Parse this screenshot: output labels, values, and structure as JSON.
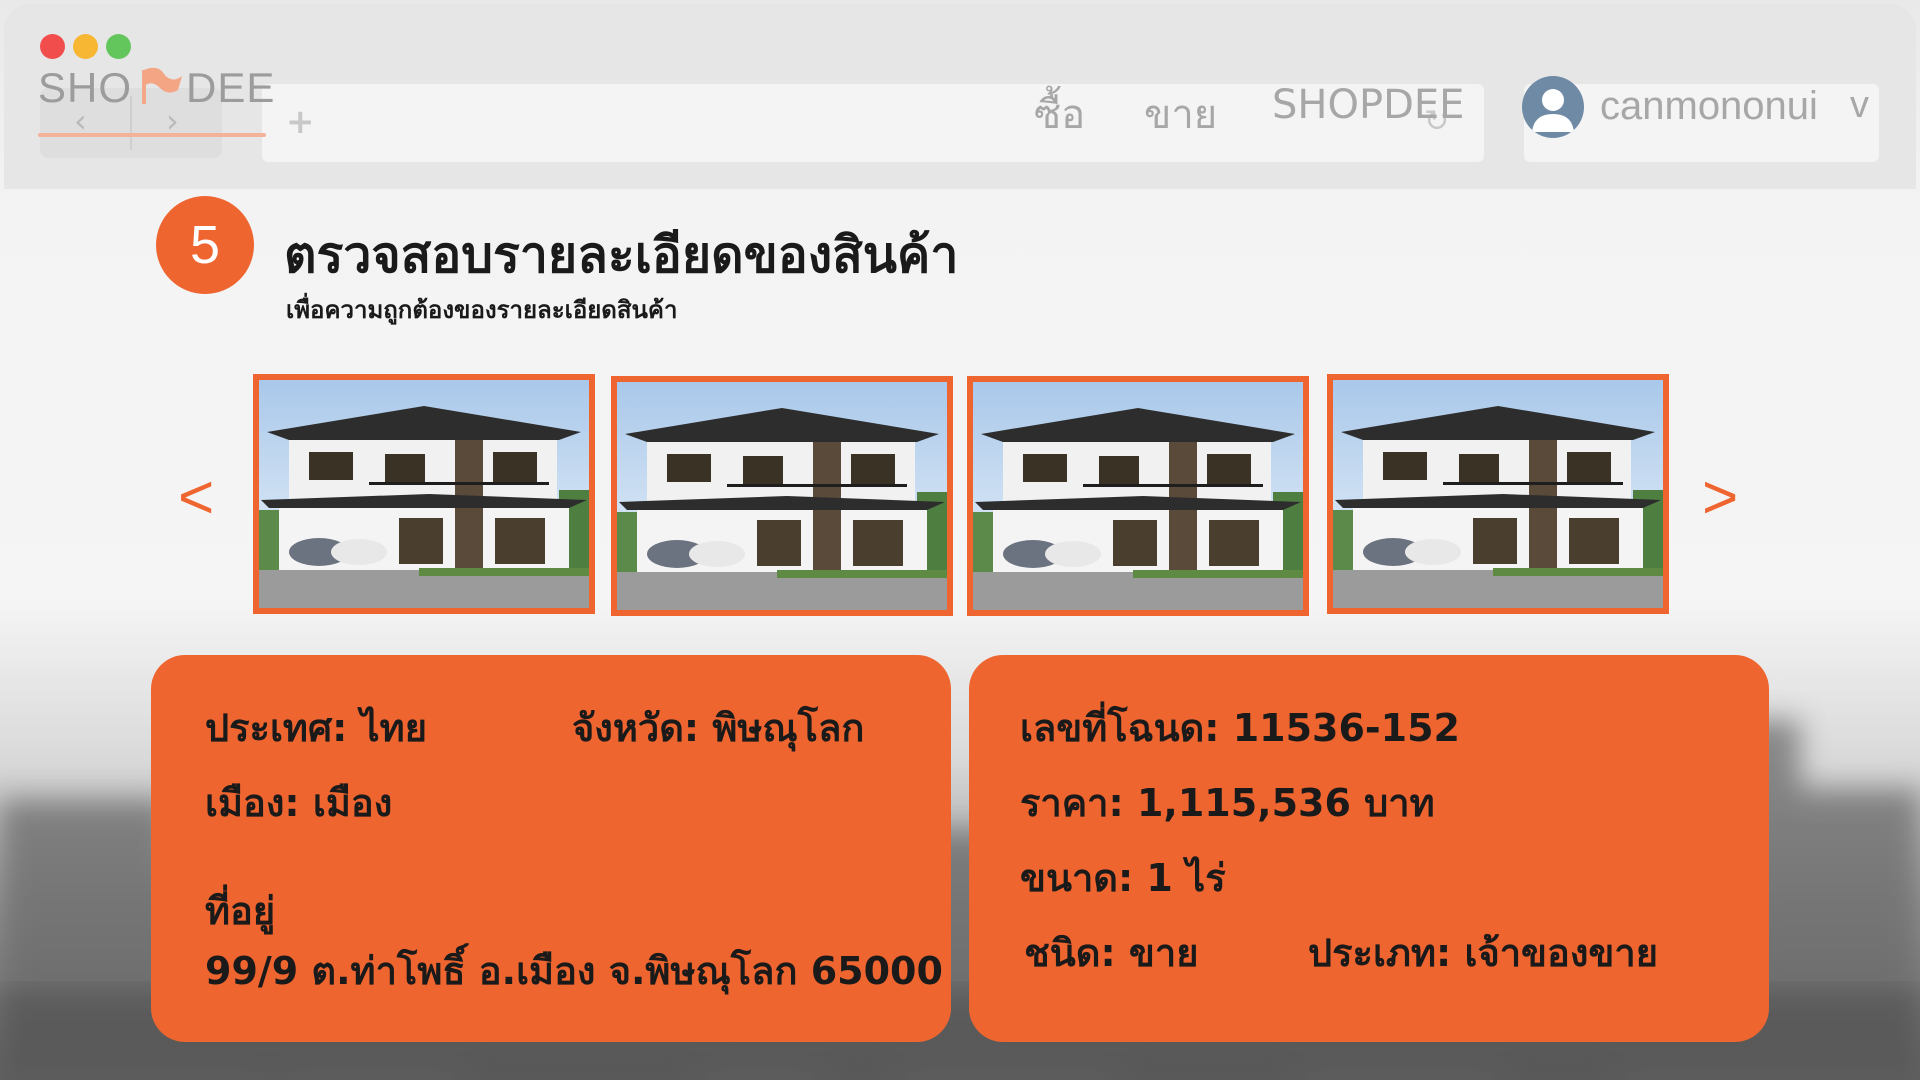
{
  "brand": {
    "logo_left": "SHO",
    "logo_right": "DEE",
    "accent_color": "#ef6530"
  },
  "menu": {
    "buy": "ซื้อ",
    "sell": "ขาย",
    "shopdee": "SHOPDEE"
  },
  "user": {
    "name": "canmononui",
    "caret": "v"
  },
  "step": {
    "number": "5",
    "title": "ตรวจสอบรายละเอียดของสินค้า",
    "subtitle": "เพื่อความถูกต้องของรายละเอียดสินค้า"
  },
  "carousel": {
    "prev": "<",
    "next": ">",
    "image_count": 4
  },
  "location": {
    "country_label": "ประเทศ:",
    "country_value": "ไทย",
    "province_label": "จังหวัด:",
    "province_value": "พิษณุโลก",
    "city_label": "เมือง:",
    "city_value": "เมือง",
    "address_label": "ที่อยู่",
    "address_value": "99/9 ต.ท่าโพธิ์ อ.เมือง จ.พิษณุโลก 65000"
  },
  "property": {
    "deed_label": "เลขที่โฉนด:",
    "deed_value": "11536-152",
    "price_label": "ราคา:",
    "price_value": "1,115,536 บาท",
    "size_label": "ขนาด:",
    "size_value": "1 ไร่",
    "kind_label": "ชนิด:",
    "kind_value": "ขาย",
    "type_label": "ประเภท:",
    "type_value": "เจ้าของขาย"
  }
}
